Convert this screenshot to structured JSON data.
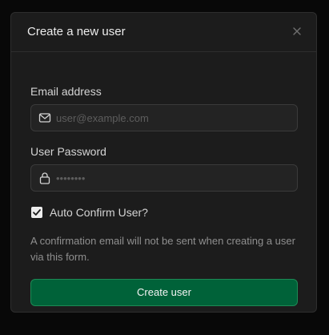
{
  "modal": {
    "title": "Create a new user",
    "close_icon": "close-icon"
  },
  "email": {
    "label": "Email address",
    "placeholder": "user@example.com",
    "value": "",
    "icon": "mail-icon"
  },
  "password": {
    "label": "User Password",
    "placeholder": "••••••••",
    "value": "",
    "icon": "lock-icon"
  },
  "auto_confirm": {
    "label": "Auto Confirm User?",
    "checked": true
  },
  "help_text": "A confirmation email will not be sent when creating a user via this form.",
  "submit": {
    "label": "Create user"
  },
  "colors": {
    "modal_bg": "#1c1c1c",
    "brand_button": "#006239",
    "brand_border": "#1d8a55"
  }
}
